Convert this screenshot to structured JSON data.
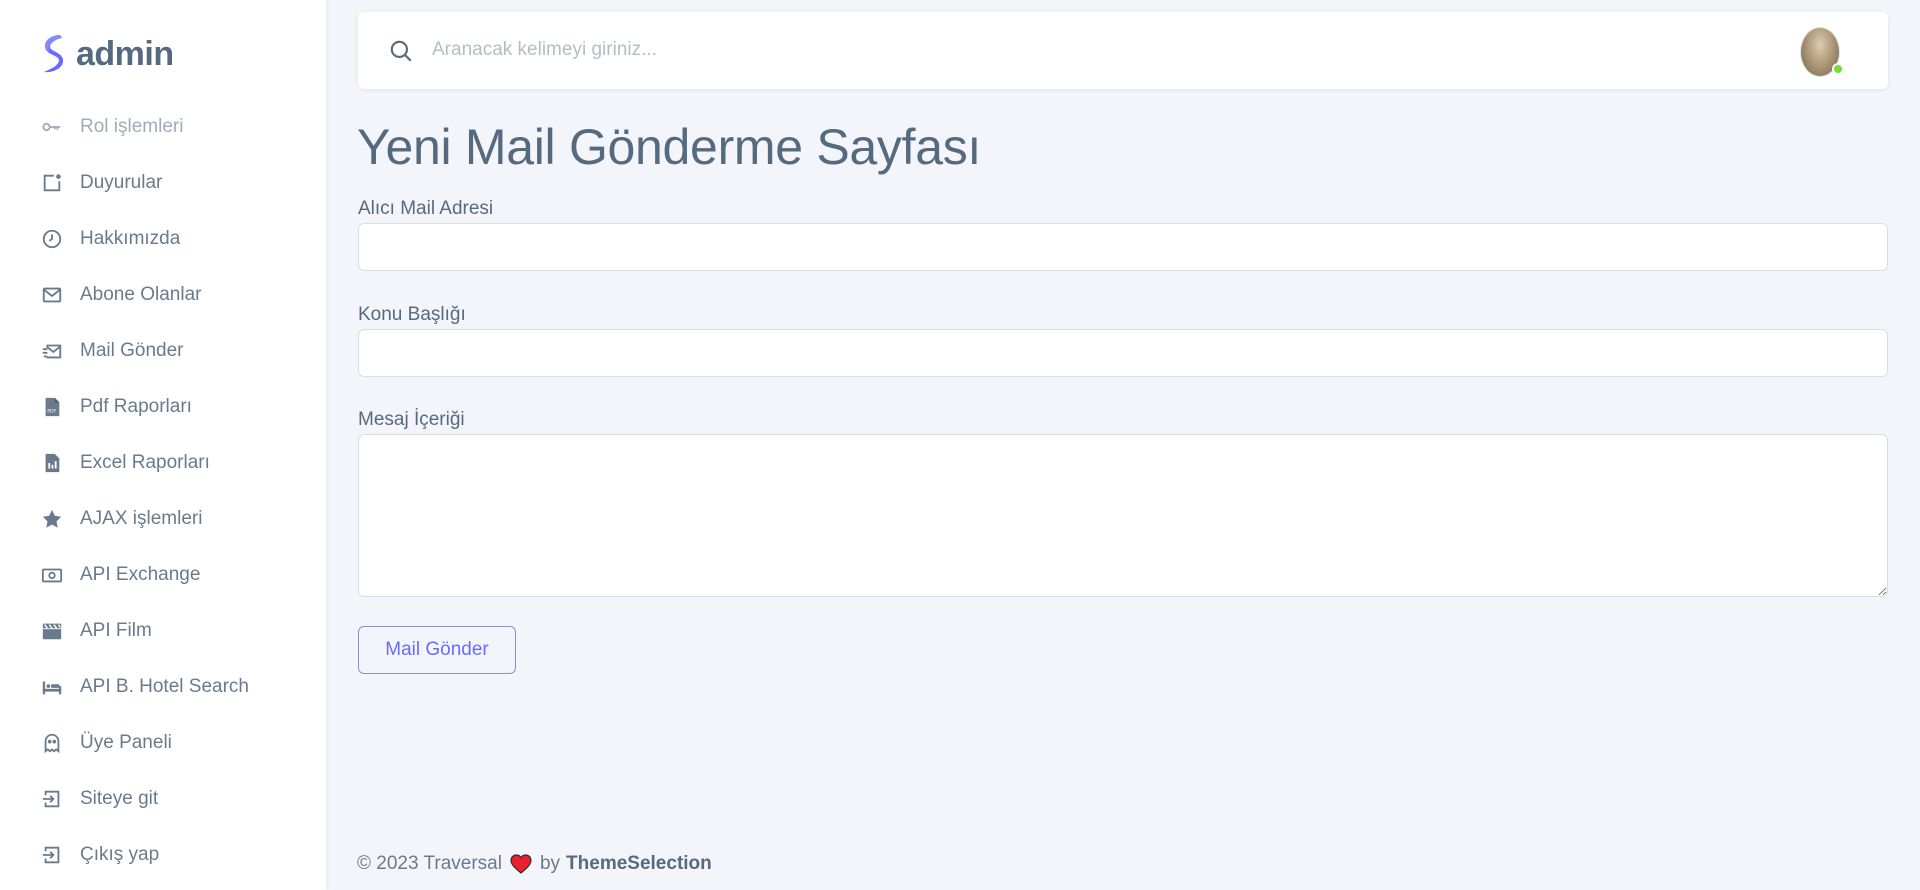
{
  "brand": {
    "name": "admin",
    "accent": "#696cff"
  },
  "sidebar": {
    "items": [
      {
        "label": "Rol işlemleri",
        "icon": "key-icon"
      },
      {
        "label": "Duyurular",
        "icon": "announcement-icon"
      },
      {
        "label": "Hakkımızda",
        "icon": "history-icon"
      },
      {
        "label": "Abone Olanlar",
        "icon": "mail-icon"
      },
      {
        "label": "Mail Gönder",
        "icon": "mail-send-icon"
      },
      {
        "label": "Pdf Raporları",
        "icon": "pdf-file-icon"
      },
      {
        "label": "Excel Raporları",
        "icon": "report-file-icon"
      },
      {
        "label": "AJAX işlemleri",
        "icon": "star-icon"
      },
      {
        "label": "API Exchange",
        "icon": "money-icon"
      },
      {
        "label": "API Film",
        "icon": "film-icon"
      },
      {
        "label": "API B. Hotel Search",
        "icon": "bed-icon"
      },
      {
        "label": "Üye Paneli",
        "icon": "ghost-icon"
      },
      {
        "label": "Siteye git",
        "icon": "log-in-icon"
      },
      {
        "label": "Çıkış yap",
        "icon": "log-out-icon"
      }
    ]
  },
  "navbar": {
    "search_placeholder": "Aranacak kelimeyi giriniz...",
    "status_color": "#71dd37"
  },
  "page": {
    "title": "Yeni Mail Gönderme Sayfası",
    "fields": {
      "recipient_label": "Alıcı Mail Adresi",
      "recipient_value": "",
      "subject_label": "Konu Başlığı",
      "subject_value": "",
      "message_label": "Mesaj İçeriği",
      "message_value": ""
    },
    "submit_label": "Mail Gönder"
  },
  "footer": {
    "copyright": "© 2023 Traversal",
    "by": "by",
    "brand": "ThemeSelection"
  }
}
